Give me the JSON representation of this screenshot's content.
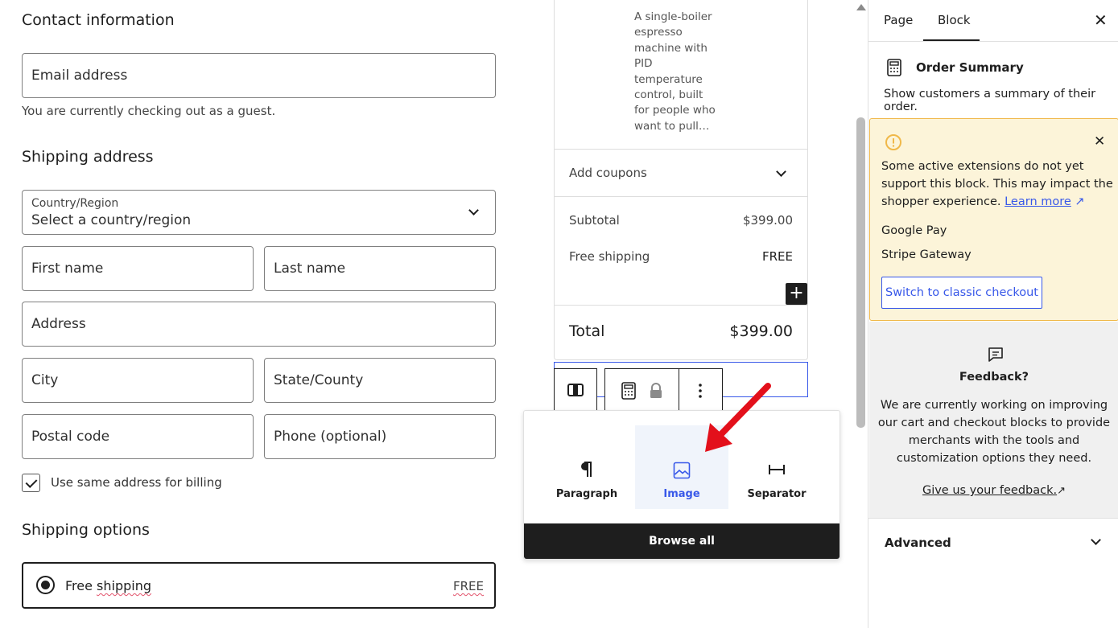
{
  "contact": {
    "heading": "Contact information",
    "email_placeholder": "Email address",
    "guest_note": "You are currently checking out as a guest."
  },
  "shipping_address": {
    "heading": "Shipping address",
    "country_label": "Country/Region",
    "country_value": "Select a country/region",
    "first_name": "First name",
    "last_name": "Last name",
    "address": "Address",
    "city": "City",
    "state": "State/County",
    "postal": "Postal code",
    "phone": "Phone (optional)",
    "same_billing": "Use same address for billing"
  },
  "shipping_options": {
    "heading": "Shipping options",
    "option_name_1": "Free",
    "option_name_2": "shipping",
    "option_price": "FREE"
  },
  "order_summary": {
    "product_desc": "A single-boiler espresso machine with PID temperature control, built for people who want to pull…",
    "desc_lines": [
      "A single-boiler",
      "espresso",
      "machine with",
      "PID",
      "temperature",
      "control, built",
      "for people who",
      "want to pull…"
    ],
    "add_coupons": "Add coupons",
    "subtotal_label": "Subtotal",
    "subtotal_value": "$399.00",
    "shipping_label": "Free shipping",
    "shipping_value": "FREE",
    "total_label": "Total",
    "total_value": "$399.00"
  },
  "inserter": {
    "items": [
      {
        "label": "Paragraph",
        "icon": "paragraph-icon"
      },
      {
        "label": "Image",
        "icon": "image-icon"
      },
      {
        "label": "Separator",
        "icon": "separator-icon"
      }
    ],
    "browse_all": "Browse all"
  },
  "sidebar": {
    "tabs": [
      "Page",
      "Block"
    ],
    "active_tab": "Block",
    "block_title": "Order Summary",
    "block_desc": "Show customers a summary of their order.",
    "warning": {
      "line1": "Some active extensions do not yet",
      "line2": "support this block. This may impact the",
      "line3": "shopper experience.",
      "learn_more": "Learn more",
      "extensions": [
        "Google Pay",
        "Stripe Gateway"
      ],
      "switch_button": "Switch to classic checkout"
    },
    "feedback": {
      "title": "Feedback?",
      "lines": [
        "We are currently working on improving",
        "our cart and checkout blocks to provide",
        "merchants with the tools and",
        "customization options they need."
      ],
      "link": "Give us your feedback."
    },
    "advanced": "Advanced"
  },
  "colors": {
    "accent": "#3858e9",
    "warning_bg": "#fcf4d9",
    "warning_border": "#f0b849",
    "arrow": "#e3101b"
  }
}
